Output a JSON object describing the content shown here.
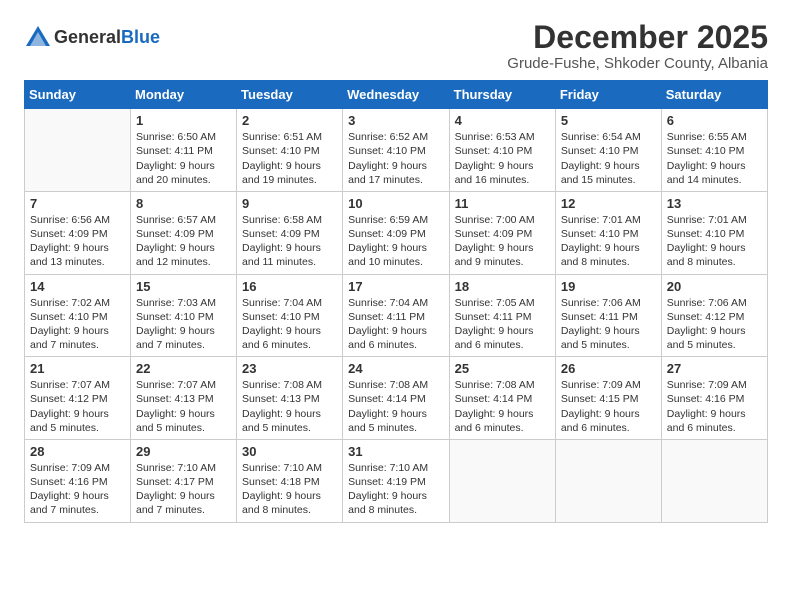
{
  "logo": {
    "general": "General",
    "blue": "Blue"
  },
  "title": "December 2025",
  "subtitle": "Grude-Fushe, Shkoder County, Albania",
  "days_of_week": [
    "Sunday",
    "Monday",
    "Tuesday",
    "Wednesday",
    "Thursday",
    "Friday",
    "Saturday"
  ],
  "weeks": [
    [
      {
        "num": "",
        "sunrise": "",
        "sunset": "",
        "daylight": ""
      },
      {
        "num": "1",
        "sunrise": "Sunrise: 6:50 AM",
        "sunset": "Sunset: 4:11 PM",
        "daylight": "Daylight: 9 hours and 20 minutes."
      },
      {
        "num": "2",
        "sunrise": "Sunrise: 6:51 AM",
        "sunset": "Sunset: 4:10 PM",
        "daylight": "Daylight: 9 hours and 19 minutes."
      },
      {
        "num": "3",
        "sunrise": "Sunrise: 6:52 AM",
        "sunset": "Sunset: 4:10 PM",
        "daylight": "Daylight: 9 hours and 17 minutes."
      },
      {
        "num": "4",
        "sunrise": "Sunrise: 6:53 AM",
        "sunset": "Sunset: 4:10 PM",
        "daylight": "Daylight: 9 hours and 16 minutes."
      },
      {
        "num": "5",
        "sunrise": "Sunrise: 6:54 AM",
        "sunset": "Sunset: 4:10 PM",
        "daylight": "Daylight: 9 hours and 15 minutes."
      },
      {
        "num": "6",
        "sunrise": "Sunrise: 6:55 AM",
        "sunset": "Sunset: 4:10 PM",
        "daylight": "Daylight: 9 hours and 14 minutes."
      }
    ],
    [
      {
        "num": "7",
        "sunrise": "Sunrise: 6:56 AM",
        "sunset": "Sunset: 4:09 PM",
        "daylight": "Daylight: 9 hours and 13 minutes."
      },
      {
        "num": "8",
        "sunrise": "Sunrise: 6:57 AM",
        "sunset": "Sunset: 4:09 PM",
        "daylight": "Daylight: 9 hours and 12 minutes."
      },
      {
        "num": "9",
        "sunrise": "Sunrise: 6:58 AM",
        "sunset": "Sunset: 4:09 PM",
        "daylight": "Daylight: 9 hours and 11 minutes."
      },
      {
        "num": "10",
        "sunrise": "Sunrise: 6:59 AM",
        "sunset": "Sunset: 4:09 PM",
        "daylight": "Daylight: 9 hours and 10 minutes."
      },
      {
        "num": "11",
        "sunrise": "Sunrise: 7:00 AM",
        "sunset": "Sunset: 4:09 PM",
        "daylight": "Daylight: 9 hours and 9 minutes."
      },
      {
        "num": "12",
        "sunrise": "Sunrise: 7:01 AM",
        "sunset": "Sunset: 4:10 PM",
        "daylight": "Daylight: 9 hours and 8 minutes."
      },
      {
        "num": "13",
        "sunrise": "Sunrise: 7:01 AM",
        "sunset": "Sunset: 4:10 PM",
        "daylight": "Daylight: 9 hours and 8 minutes."
      }
    ],
    [
      {
        "num": "14",
        "sunrise": "Sunrise: 7:02 AM",
        "sunset": "Sunset: 4:10 PM",
        "daylight": "Daylight: 9 hours and 7 minutes."
      },
      {
        "num": "15",
        "sunrise": "Sunrise: 7:03 AM",
        "sunset": "Sunset: 4:10 PM",
        "daylight": "Daylight: 9 hours and 7 minutes."
      },
      {
        "num": "16",
        "sunrise": "Sunrise: 7:04 AM",
        "sunset": "Sunset: 4:10 PM",
        "daylight": "Daylight: 9 hours and 6 minutes."
      },
      {
        "num": "17",
        "sunrise": "Sunrise: 7:04 AM",
        "sunset": "Sunset: 4:11 PM",
        "daylight": "Daylight: 9 hours and 6 minutes."
      },
      {
        "num": "18",
        "sunrise": "Sunrise: 7:05 AM",
        "sunset": "Sunset: 4:11 PM",
        "daylight": "Daylight: 9 hours and 6 minutes."
      },
      {
        "num": "19",
        "sunrise": "Sunrise: 7:06 AM",
        "sunset": "Sunset: 4:11 PM",
        "daylight": "Daylight: 9 hours and 5 minutes."
      },
      {
        "num": "20",
        "sunrise": "Sunrise: 7:06 AM",
        "sunset": "Sunset: 4:12 PM",
        "daylight": "Daylight: 9 hours and 5 minutes."
      }
    ],
    [
      {
        "num": "21",
        "sunrise": "Sunrise: 7:07 AM",
        "sunset": "Sunset: 4:12 PM",
        "daylight": "Daylight: 9 hours and 5 minutes."
      },
      {
        "num": "22",
        "sunrise": "Sunrise: 7:07 AM",
        "sunset": "Sunset: 4:13 PM",
        "daylight": "Daylight: 9 hours and 5 minutes."
      },
      {
        "num": "23",
        "sunrise": "Sunrise: 7:08 AM",
        "sunset": "Sunset: 4:13 PM",
        "daylight": "Daylight: 9 hours and 5 minutes."
      },
      {
        "num": "24",
        "sunrise": "Sunrise: 7:08 AM",
        "sunset": "Sunset: 4:14 PM",
        "daylight": "Daylight: 9 hours and 5 minutes."
      },
      {
        "num": "25",
        "sunrise": "Sunrise: 7:08 AM",
        "sunset": "Sunset: 4:14 PM",
        "daylight": "Daylight: 9 hours and 6 minutes."
      },
      {
        "num": "26",
        "sunrise": "Sunrise: 7:09 AM",
        "sunset": "Sunset: 4:15 PM",
        "daylight": "Daylight: 9 hours and 6 minutes."
      },
      {
        "num": "27",
        "sunrise": "Sunrise: 7:09 AM",
        "sunset": "Sunset: 4:16 PM",
        "daylight": "Daylight: 9 hours and 6 minutes."
      }
    ],
    [
      {
        "num": "28",
        "sunrise": "Sunrise: 7:09 AM",
        "sunset": "Sunset: 4:16 PM",
        "daylight": "Daylight: 9 hours and 7 minutes."
      },
      {
        "num": "29",
        "sunrise": "Sunrise: 7:10 AM",
        "sunset": "Sunset: 4:17 PM",
        "daylight": "Daylight: 9 hours and 7 minutes."
      },
      {
        "num": "30",
        "sunrise": "Sunrise: 7:10 AM",
        "sunset": "Sunset: 4:18 PM",
        "daylight": "Daylight: 9 hours and 8 minutes."
      },
      {
        "num": "31",
        "sunrise": "Sunrise: 7:10 AM",
        "sunset": "Sunset: 4:19 PM",
        "daylight": "Daylight: 9 hours and 8 minutes."
      },
      {
        "num": "",
        "sunrise": "",
        "sunset": "",
        "daylight": ""
      },
      {
        "num": "",
        "sunrise": "",
        "sunset": "",
        "daylight": ""
      },
      {
        "num": "",
        "sunrise": "",
        "sunset": "",
        "daylight": ""
      }
    ]
  ]
}
